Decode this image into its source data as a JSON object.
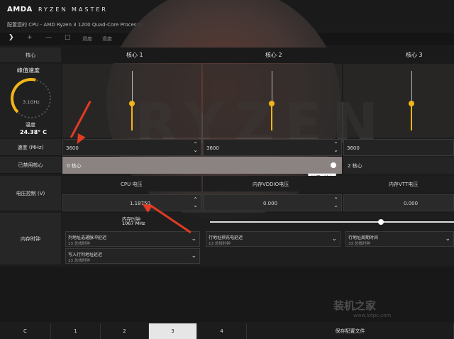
{
  "header": {
    "brand": "AMDA",
    "product": "RYZEN MASTER",
    "cpu_title": "配置您的 CPU - AMD Ryzen 3 1200 Quad-Core Processor"
  },
  "toolbar": {
    "icons": [
      "chevron-right-icon",
      "plus-icon",
      "minus-icon",
      "square-icon"
    ],
    "items": [
      "退度",
      "退度"
    ]
  },
  "left_labels": {
    "core": "核心",
    "speed": "速度 (MHz)",
    "disabled": "已禁用核心",
    "voltage": "电压控制 (V)",
    "memory": "内存时钟"
  },
  "gauge": {
    "title": "峰值速度",
    "value": "3.1GHz",
    "temp_label": "温度",
    "temp_value": "24.38° C",
    "fill_fraction": 0.55,
    "accent": "#f2b418"
  },
  "cores": [
    {
      "name": "核心 1",
      "speed": "3600",
      "disabled": "0 核心",
      "slider_level": 0.45
    },
    {
      "name": "核心 2",
      "speed": "3600",
      "disabled": "",
      "slider_level": 0.45
    },
    {
      "name": "核心 3",
      "speed": "3600",
      "disabled": "2 核心",
      "slider_level": 0.45
    }
  ],
  "tooltip": "禁用0核心",
  "voltage": {
    "cpu_label": "CPU 电压",
    "cpu_value": "1.18750",
    "vddio_label": "内存VDDIO电压",
    "vddio_value": "0.000",
    "vtt_label": "内存VTT电压",
    "vtt_value": "0.000"
  },
  "memory": {
    "clock_label": "内存时钟",
    "clock_value": "1067 MHz",
    "slider_level": 0.7,
    "timings": [
      {
        "title": "列地址选通脉冲延迟",
        "sub": "13 总线时钟"
      },
      {
        "title": "行地址预充电延迟",
        "sub": "13 总线时钟"
      },
      {
        "title": "行地址周期时间",
        "sub": "33 总线时钟"
      },
      {
        "title": "写入行列地址延迟",
        "sub": "13 总线时钟"
      }
    ]
  },
  "bottom_tabs": [
    "C",
    "1",
    "2",
    "3",
    "4"
  ],
  "active_tab": "3",
  "save_label": "保存配置文件",
  "watermark": {
    "text": "装机之家",
    "url": "www.lotpc.com"
  }
}
